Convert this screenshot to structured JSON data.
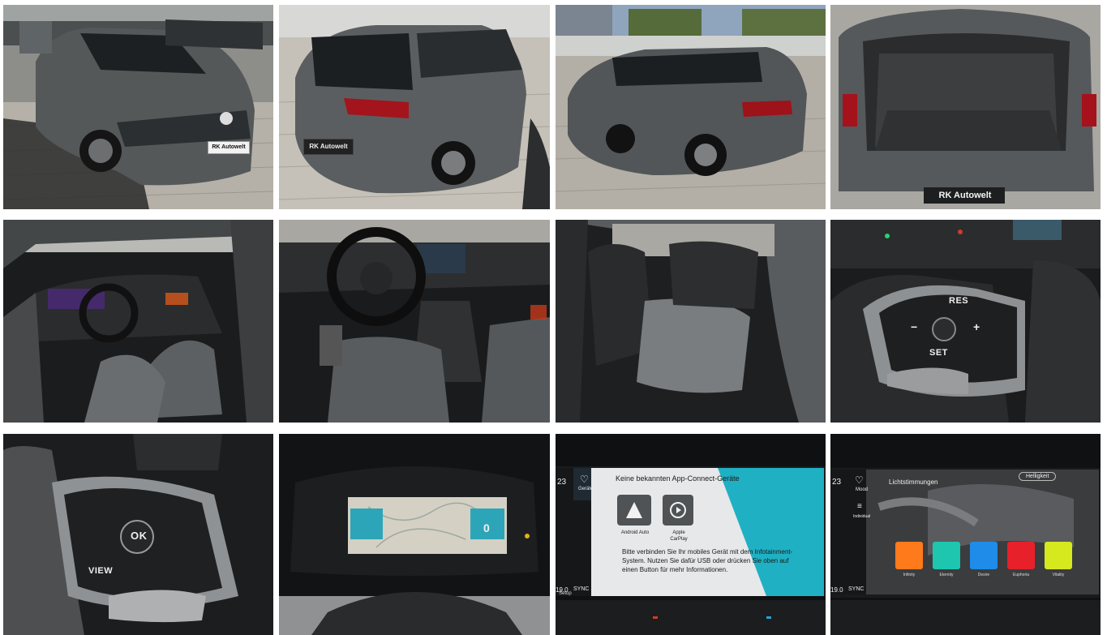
{
  "gallery": {
    "tiles": [
      {
        "name": "exterior-front"
      },
      {
        "name": "exterior-rear"
      },
      {
        "name": "exterior-side-rear"
      },
      {
        "name": "trunk-open"
      },
      {
        "name": "interior-driver-door"
      },
      {
        "name": "interior-dashboard"
      },
      {
        "name": "interior-rear-seats"
      },
      {
        "name": "steering-wheel-right-controls"
      },
      {
        "name": "steering-wheel-left-controls"
      },
      {
        "name": "digital-cockpit"
      },
      {
        "name": "infotainment-app-connect"
      },
      {
        "name": "infotainment-ambient-light"
      }
    ]
  },
  "plates": {
    "front": "RK Autowelt",
    "rear": "RK Autowelt",
    "trunk": "RK Autowelt"
  },
  "wheel_right": {
    "res": "RES",
    "set": "SET",
    "minus": "−",
    "plus": "+"
  },
  "wheel_left": {
    "ok": "OK",
    "view": "VIEW"
  },
  "app_connect": {
    "side_number": "23",
    "heart_label": "Geräte",
    "title": "Keine bekannten App-Connect-Geräte",
    "android_label": "Android Auto",
    "apple_label": "Apple CarPlay",
    "body_text": "Bitte verbinden Sie Ihr mobiles Gerät mit dem Infotainment-System. Nutzen Sie dafür USB oder drücken Sie oben auf einen Button für mehr Informationen.",
    "setup_label": "Setup",
    "temp": "19.0",
    "sync": "SYNC"
  },
  "ambient": {
    "side_number": "23",
    "heart_label": "Mood",
    "slider_label": "Individual",
    "title": "Lichtstimmungen",
    "brightness": "Helligkeit",
    "temp": "19.0",
    "sync": "SYNC",
    "moods": [
      {
        "label": "Infinity",
        "color": "#ff7a1a"
      },
      {
        "label": "Eternity",
        "color": "#1ec6b0"
      },
      {
        "label": "Desire",
        "color": "#1e8ce8"
      },
      {
        "label": "Euphoria",
        "color": "#e8202a"
      },
      {
        "label": "Vitality",
        "color": "#d6e81e"
      }
    ]
  },
  "cockpit": {
    "speed_right": "0"
  }
}
